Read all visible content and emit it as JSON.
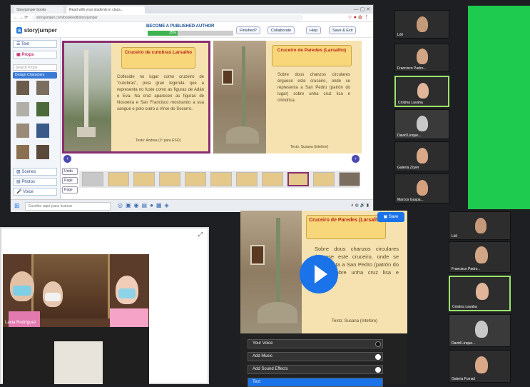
{
  "browser": {
    "tabs": [
      "Storyjumper books",
      "Read with your students in class..."
    ],
    "url": "storyjumper.com/book/edit/storyjumper",
    "app_logo": "storyjumper",
    "publish_text": "BECOME A PUBLISHED AUTHOR",
    "progress_label": "35%",
    "progress_value": 35,
    "buttons": [
      "Finished?",
      "Collaborate",
      "Help",
      "Save & Exit"
    ]
  },
  "left_panel": {
    "text_label": "Text",
    "props_label": "Props",
    "search_placeholder": "Search Props",
    "design_button": "Design Characters",
    "scenes_label": "Scenes",
    "photos_label": "Photos",
    "voice_label": "Voice"
  },
  "side_buttons": [
    "Undo",
    "Page",
    "Page"
  ],
  "book": {
    "left_title": "Cruceiro de cutobras Larsalho",
    "left_body": "Colleside no lugar como cruzeiro de \"cutobras\", pola gran legenda que a representa no fuste como as figuras de Adán e Eva. Na cruz aparecen as figuras de Nosoeira e San Francisco mostrando a sua sangue e polo outro a Virxe do Socorro.",
    "left_sig": "Texto: Andrea (1º para ESO)",
    "right_title": "Cruceiro de Paredes (Larsalho)",
    "right_body": "Sobre dous chanzos circulares érguese este cruceiro, onde se representa a San Pedro (patrón do lugar) sobre unha cruz lisa e cilíndrica.",
    "right_sig": "Texto: Susana (Intefore)"
  },
  "taskbar": {
    "search_text": "Escribe aquí para buscar"
  },
  "gallery_top": [
    "Lóil",
    "Francisco Padro...",
    "Cristina Lavaha",
    "David Linque...",
    "Galería Zoyer",
    "Marcos Gaspa..."
  ],
  "gallery_bottom": [
    "Lóil",
    "Francisco Padro...",
    "Cristina Lavaha",
    "David Linque...",
    "Galería Fomail"
  ],
  "viewer": {
    "save_label": "Save",
    "title": "Cruceiro de Paredes (Larsalho)",
    "body": "Sobre dous chanzos circulares érguese este cruceiro, onde se representa a San Pedro (patrón do lugar) sobre unha cruz lisa e cilíndrica.",
    "sig": "Texto: Susana (Intefore)",
    "rows": [
      "Your Voice",
      "Add Music",
      "Add Sound Effects",
      "Text"
    ]
  },
  "overlay": {
    "name": "Lavia Rodríguez"
  },
  "colors": {
    "accent": "#1a73e8",
    "green_screen": "#1ecb4f",
    "page_frame": "#8a2d6e",
    "highlight": "#9be36b"
  }
}
